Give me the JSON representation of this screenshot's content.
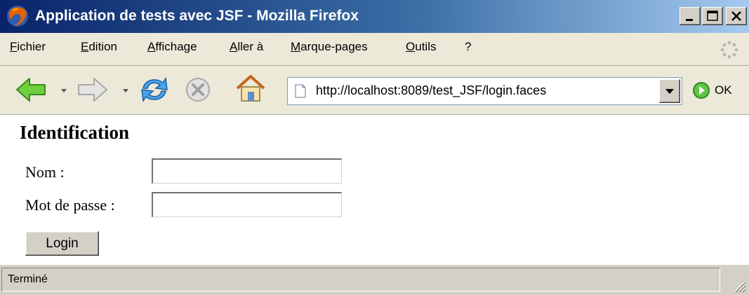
{
  "window": {
    "title": "Application de tests avec JSF - Mozilla Firefox"
  },
  "menu": [
    "Fichier",
    "Edition",
    "Affichage",
    "Aller à",
    "Marque-pages",
    "Outils",
    "?"
  ],
  "toolbar": {
    "url": "http://localhost:8089/test_JSF/login.faces",
    "go_label": "OK"
  },
  "page": {
    "heading": "Identification",
    "name_label": "Nom :",
    "name_value": "",
    "password_label": "Mot de passe :",
    "password_value": "",
    "login_button": "Login"
  },
  "status": {
    "text": "Terminé"
  },
  "colors": {
    "titlebar_start": "#0a246a",
    "titlebar_end": "#a6caf0",
    "chrome": "#d4d0c8"
  },
  "icons": [
    "firefox-icon",
    "back-icon",
    "forward-icon",
    "reload-icon",
    "stop-icon",
    "home-icon",
    "page-icon",
    "go-icon",
    "throbber-icon",
    "resize-grip-icon"
  ]
}
